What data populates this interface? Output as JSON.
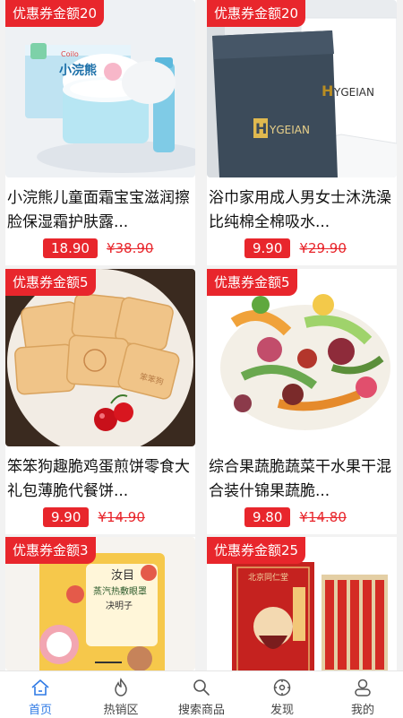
{
  "products": [
    {
      "coupon": "优惠券金额20",
      "title": "小浣熊儿童面霜宝宝滋润擦脸保湿霜护肤露...",
      "price": "18.90",
      "original": "¥38.90"
    },
    {
      "coupon": "优惠券金额20",
      "title": "浴巾家用成人男女士沐洗澡比纯棉全棉吸水...",
      "price": "9.90",
      "original": "¥29.90"
    },
    {
      "coupon": "优惠券金额5",
      "title": "笨笨狗趣脆鸡蛋煎饼零食大礼包薄脆代餐饼...",
      "price": "9.90",
      "original": "¥14.90"
    },
    {
      "coupon": "优惠券金额5",
      "title": "综合果蔬脆蔬菜干水果干混合装什锦果蔬脆...",
      "price": "9.80",
      "original": "¥14.80"
    },
    {
      "coupon": "优惠券金额3",
      "title": "",
      "price": "",
      "original": ""
    },
    {
      "coupon": "优惠券金额25",
      "title": "",
      "price": "",
      "original": ""
    }
  ],
  "image_text": {
    "cream_brand": "小浣熊",
    "cream_brand_small": "Coilo",
    "towel_brand": "YGEIAN",
    "towel_initial": "H",
    "biscuit_stamp": "笨笨狗",
    "eye_brand": "汝目",
    "eye_line1": "蒸汽热敷眼罩",
    "eye_line2": "决明子",
    "tea_brand": "北京同仁堂"
  },
  "tabbar": [
    {
      "label": "首页",
      "icon": "home-icon",
      "active": true
    },
    {
      "label": "热销区",
      "icon": "flame-icon",
      "active": false
    },
    {
      "label": "搜索商品",
      "icon": "search-icon",
      "active": false
    },
    {
      "label": "发现",
      "icon": "compass-icon",
      "active": false
    },
    {
      "label": "我的",
      "icon": "user-icon",
      "active": false
    }
  ],
  "colors": {
    "accent": "#e8262c",
    "tab_active": "#2f7ae5",
    "tab_inactive": "#444444"
  }
}
